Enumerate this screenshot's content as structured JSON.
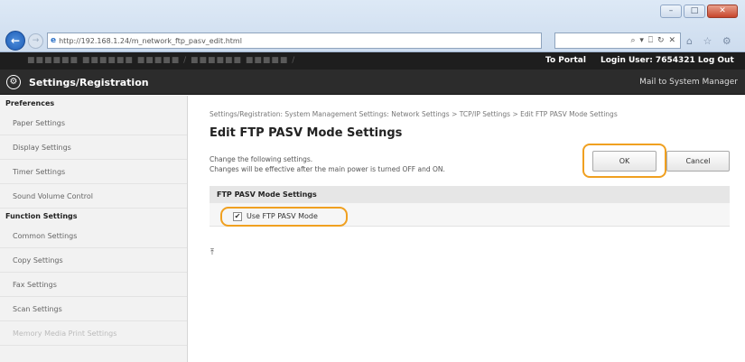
{
  "browser": {
    "address": "http://192.168.1.24/m_network_ftp_pasv_edit.html",
    "address_tools": "⌕ ▾ ⎕ ↻ ✕",
    "back_glyph": "←",
    "fwd_glyph": "→",
    "win_min": "–",
    "win_max": "□",
    "win_close": "✕",
    "fav_glyphs": "⌂ ☆ ⚙"
  },
  "header": {
    "device": "■■■■■■   ■■■■■■ ■■■■■ / ■■■■■■ ■■■■■ /",
    "to_portal": "To Portal",
    "login_user": "Login User:  7654321  Log Out",
    "title": "Settings/Registration",
    "mail": "Mail to System Manager",
    "gear_glyph": "⚙"
  },
  "sidebar": {
    "cat1": "Preferences",
    "items1": [
      "Paper Settings",
      "Display Settings",
      "Timer Settings",
      "Sound Volume Control"
    ],
    "cat2": "Function Settings",
    "items2": [
      "Common Settings",
      "Copy Settings",
      "Fax Settings",
      "Scan Settings",
      "Memory Media Print Settings"
    ]
  },
  "main": {
    "breadcrumb": "Settings/Registration: System Management Settings: Network Settings > TCP/IP Settings > Edit FTP PASV Mode Settings",
    "title": "Edit FTP PASV Mode Settings",
    "instruction1": "Change the following settings.",
    "instruction2": "Changes will be effective after the main power is turned OFF and ON.",
    "ok": "OK",
    "cancel": "Cancel",
    "section_title": "FTP PASV Mode Settings",
    "checkbox_label": "Use FTP PASV Mode",
    "checkbox_mark": "✔",
    "top_glyph": "⤒"
  },
  "colors": {
    "highlight": "#f0a020",
    "header_dark": "#2c2c2c",
    "sidebar_bg": "#f2f2f2"
  }
}
